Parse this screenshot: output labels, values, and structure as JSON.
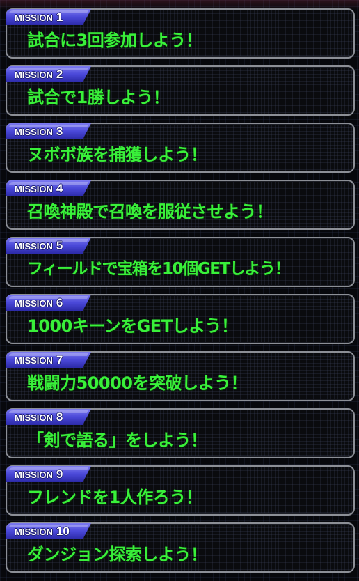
{
  "colors": {
    "mission_text": "#39f03a",
    "tag_fill": "#4a48d8",
    "card_border": "#8c8f96"
  },
  "missions": [
    {
      "label": "MISSION",
      "number": "1",
      "text": "試合に3回参加しよう！"
    },
    {
      "label": "MISSION",
      "number": "2",
      "text": "試合で1勝しよう！"
    },
    {
      "label": "MISSION",
      "number": "3",
      "text": "ヌボボ族を捕獲しよう！"
    },
    {
      "label": "MISSION",
      "number": "4",
      "text": "召喚神殿で召喚を服従させよう！"
    },
    {
      "label": "MISSION",
      "number": "5",
      "text": "フィールドで宝箱を10個GETしよう！"
    },
    {
      "label": "MISSION",
      "number": "6",
      "text": "1000キーンをGETしよう！"
    },
    {
      "label": "MISSION",
      "number": "7",
      "text": "戦闘力50000を突破しよう！"
    },
    {
      "label": "MISSION",
      "number": "8",
      "text": "「剣で語る」をしよう！"
    },
    {
      "label": "MISSION",
      "number": "9",
      "text": "フレンドを1人作ろう！"
    },
    {
      "label": "MISSION",
      "number": "10",
      "text": "ダンジョン探索しよう！"
    }
  ]
}
